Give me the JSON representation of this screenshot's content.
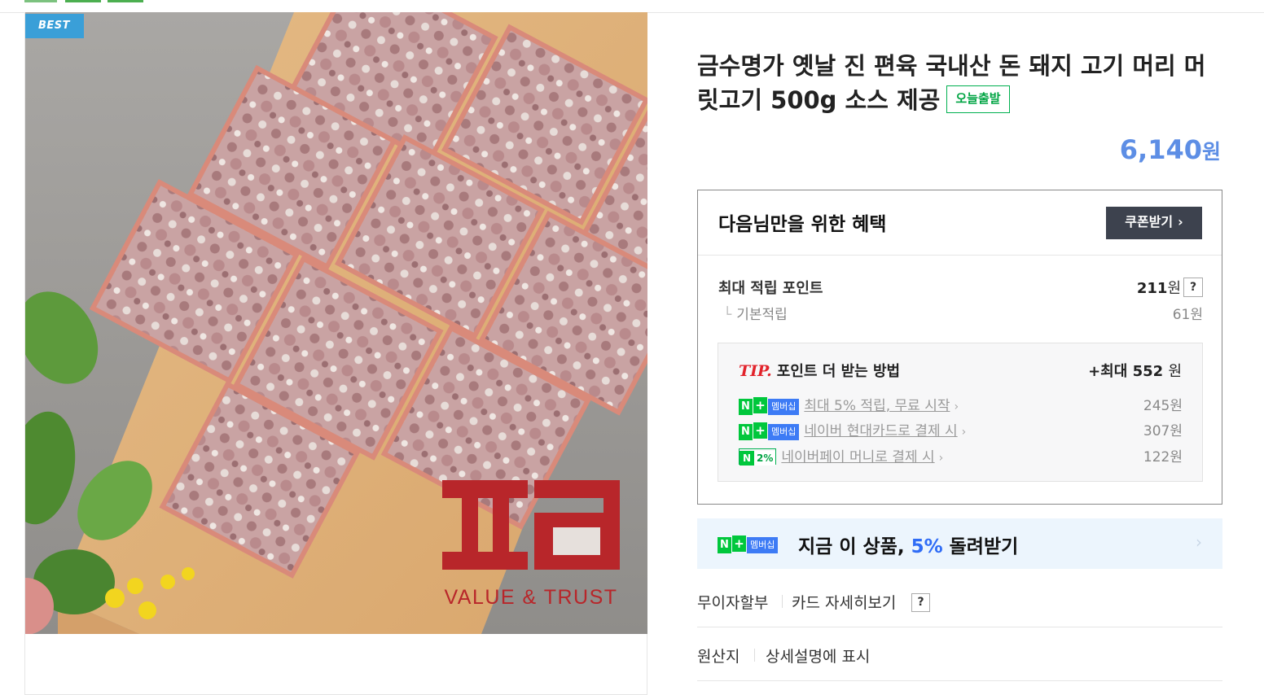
{
  "product": {
    "badge": "BEST",
    "title": "금수명가 옛날 진 편육 국내산 돈 돼지 고기 머리 머릿고기 500g 소스 제공",
    "shipping_badge": "오늘출발",
    "price": "6,140",
    "price_unit": "원",
    "brand_logo_text": "VALUE & TRUST"
  },
  "benefit": {
    "title": "다음님만을 위한 혜택",
    "coupon_button": "쿠폰받기",
    "max_points_label": "최대 적립 포인트",
    "max_points_value": "211",
    "max_points_unit": "원",
    "help_icon": "?",
    "basic_label": "기본적립",
    "basic_value": "61원",
    "tip": {
      "tip_label": "TIP.",
      "title": "포인트 더 받는 방법",
      "max_prefix": "+최대",
      "max_value": "552",
      "max_unit": "원",
      "rows": [
        {
          "badge_n": "N",
          "badge_plus": "+",
          "badge_text": "멤버십",
          "text": "최대 5% 적립, 무료 시작",
          "value": "245원"
        },
        {
          "badge_n": "N",
          "badge_plus": "+",
          "badge_text": "멤버십",
          "text": "네이버 현대카드로 결제 시",
          "value": "307원"
        },
        {
          "badge_n": "N",
          "badge_pct": "2%",
          "text": "네이버페이 머니로 결제 시",
          "value": "122원"
        }
      ]
    }
  },
  "promo": {
    "badge_n": "N",
    "badge_plus": "+",
    "badge_text": "멤버십",
    "text_before": "지금 이 상품, ",
    "highlight": "5%",
    "text_after": " 돌려받기"
  },
  "meta": {
    "installment_label": "무이자할부",
    "card_details": "카드 자세히보기",
    "card_help": "?",
    "origin_label": "원산지",
    "origin_value": "상세설명에 표시"
  },
  "colors": {
    "price": "#5d8ee5",
    "best_badge": "#3a9fd8",
    "ship_badge": "#00a443",
    "promo_bg": "#ecf5fd",
    "promo_highlight": "#2f6cf6",
    "logo_red": "#b8262a"
  }
}
